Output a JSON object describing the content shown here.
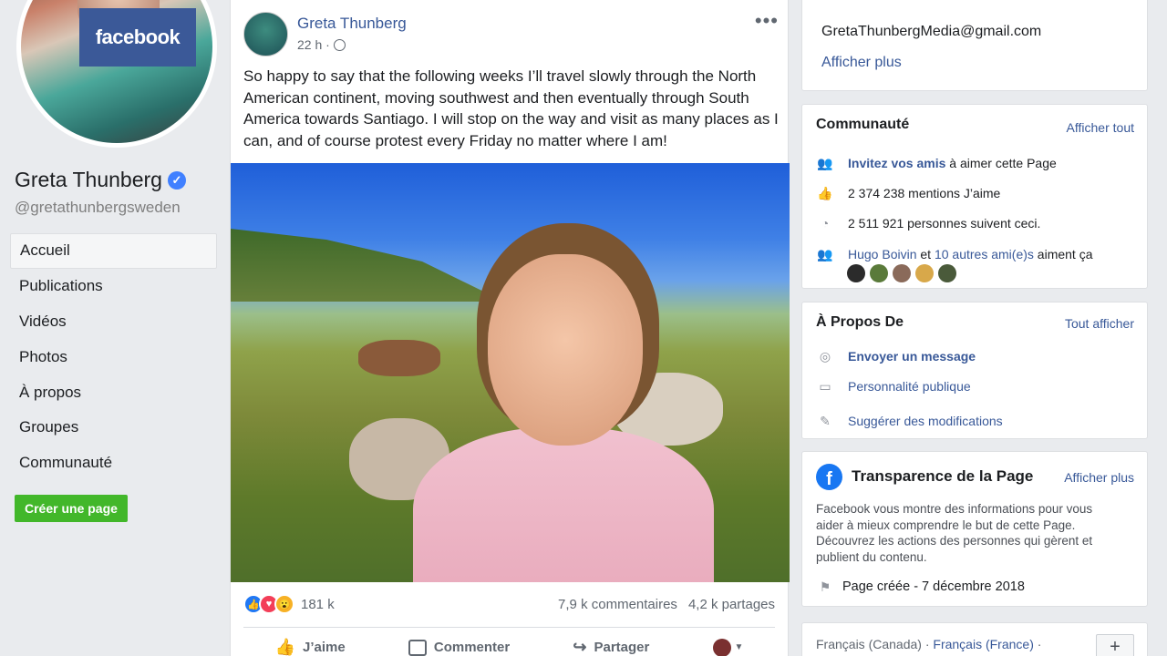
{
  "profile": {
    "logo_text": "facebook",
    "name": "Greta Thunberg",
    "handle": "@gretathunbergsweden",
    "create_page": "Créer une page"
  },
  "nav": [
    {
      "label": "Accueil",
      "active": true
    },
    {
      "label": "Publications"
    },
    {
      "label": "Vidéos"
    },
    {
      "label": "Photos"
    },
    {
      "label": "À propos"
    },
    {
      "label": "Groupes"
    },
    {
      "label": "Communauté"
    }
  ],
  "post": {
    "author": "Greta Thunberg",
    "time": "22 h ·",
    "text": "So happy to say that the following weeks I’ll travel slowly through the North American continent, moving southwest and then eventually through South America towards Santiago. I will stop on the way and visit as many places as I can, and of course protest every Friday no matter where I am!",
    "reaction_count": "181 k",
    "comments": "7,9 k commentaires",
    "shares": "4,2 k partages",
    "actions": {
      "like": "J’aime",
      "comment": "Commenter",
      "share": "Partager"
    }
  },
  "contact": {
    "email": "GretaThunbergMedia@gmail.com",
    "more": "Afficher plus"
  },
  "community": {
    "title": "Communauté",
    "link": "Afficher tout",
    "invite_bold": "Invitez vos amis",
    "invite_rest": " à aimer cette Page",
    "likes": "2 374 238 mentions J’aime",
    "followers": "2 511 921 personnes suivent ceci.",
    "friend_name": "Hugo Boivin",
    "friend_mid": " et ",
    "friend_others": "10 autres ami(e)s",
    "friend_end": " aiment ça"
  },
  "about": {
    "title": "À Propos De",
    "link": "Tout afficher",
    "message": "Envoyer un message",
    "category": "Personnalité publique",
    "suggest": "Suggérer des modifications"
  },
  "transparency": {
    "title": "Transparence de la Page",
    "link": "Afficher plus",
    "text": "Facebook vous montre des informations pour vous aider à mieux comprendre le but de cette Page. Découvrez les actions des personnes qui gèrent et publient du contenu.",
    "created": "Page créée - 7 décembre 2018"
  },
  "languages": {
    "first": "Français (Canada) · ",
    "second": "Français (France)",
    "sep": " ·"
  }
}
